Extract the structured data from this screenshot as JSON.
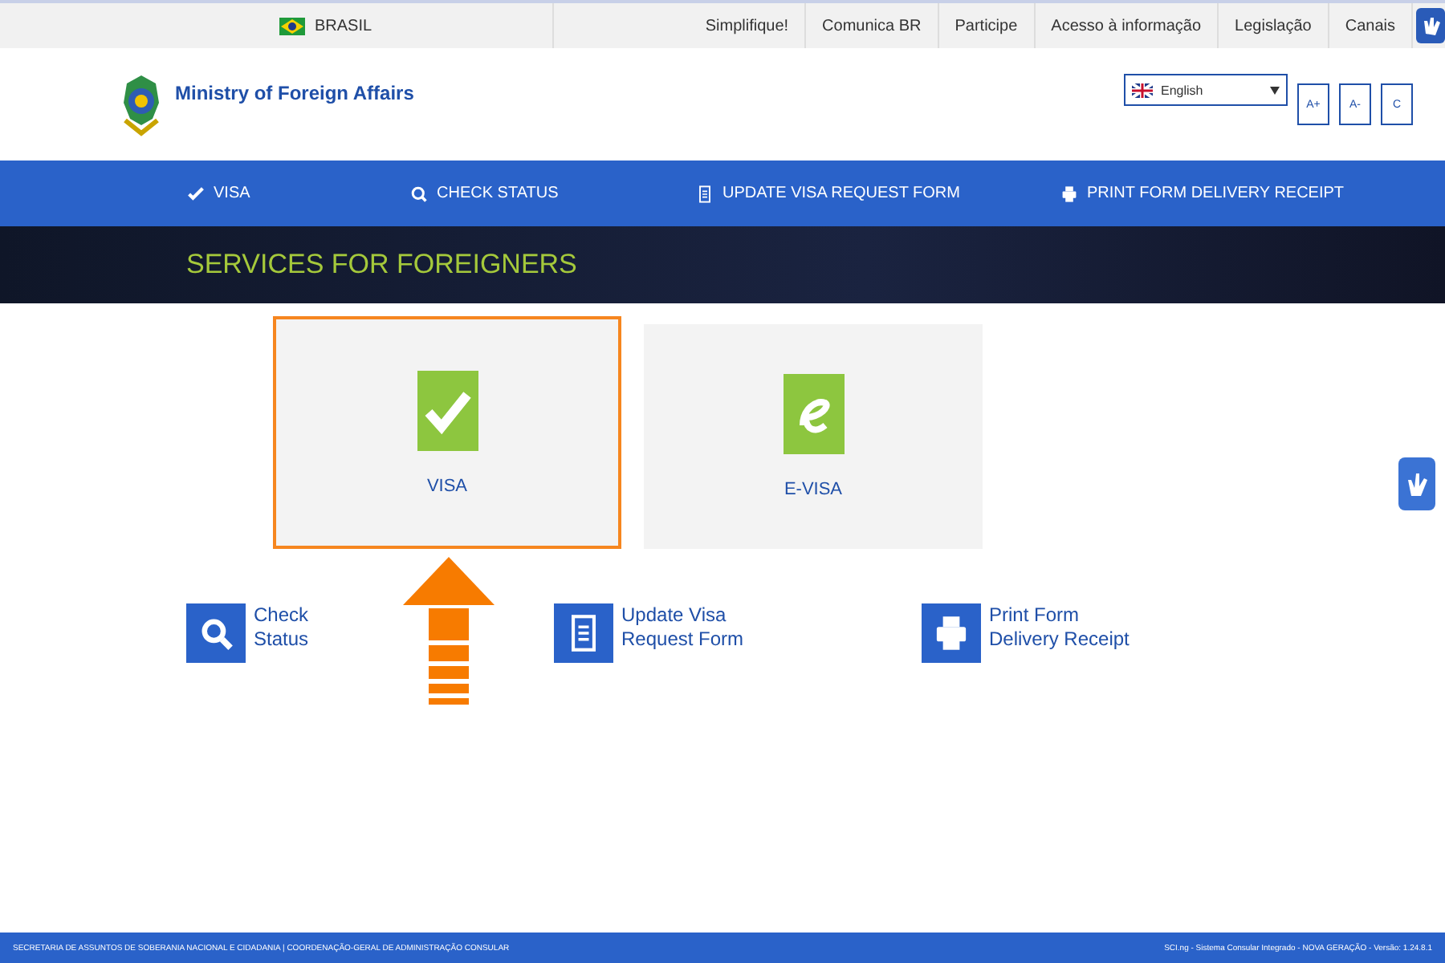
{
  "gov_bar": {
    "country": "BRASIL",
    "links": [
      "Simplifique!",
      "Comunica BR",
      "Participe",
      "Acesso à informação",
      "Legislação",
      "Canais"
    ]
  },
  "header": {
    "title": "Ministry of Foreign Affairs",
    "language": "English",
    "font_buttons": [
      "A+",
      "A-",
      "C"
    ]
  },
  "nav": [
    {
      "kind": "check",
      "label": "VISA"
    },
    {
      "kind": "search",
      "label": "CHECK STATUS"
    },
    {
      "kind": "document",
      "label": "UPDATE VISA REQUEST FORM"
    },
    {
      "kind": "printer",
      "label": "PRINT FORM DELIVERY RECEIPT"
    }
  ],
  "banner": {
    "title": "SERVICES FOR FOREIGNERS"
  },
  "cards": [
    {
      "kind": "check",
      "label": "VISA",
      "selected": true
    },
    {
      "kind": "evisa",
      "label": "E-VISA",
      "selected": false
    }
  ],
  "links": [
    {
      "kind": "search",
      "lines": [
        "Check",
        "Status"
      ]
    },
    {
      "kind": "document",
      "lines": [
        "Update Visa",
        "Request Form"
      ]
    },
    {
      "kind": "printer",
      "lines": [
        "Print Form",
        "Delivery Receipt"
      ]
    }
  ],
  "footer": {
    "left": "SECRETARIA DE ASSUNTOS DE SOBERANIA NACIONAL E CIDADANIA | COORDENAÇÃO-GERAL DE ADMINISTRAÇÃO CONSULAR",
    "right": "SCI.ng - Sistema Consular Integrado - NOVA GERAÇÃO - Versão: 1.24.8.1"
  }
}
